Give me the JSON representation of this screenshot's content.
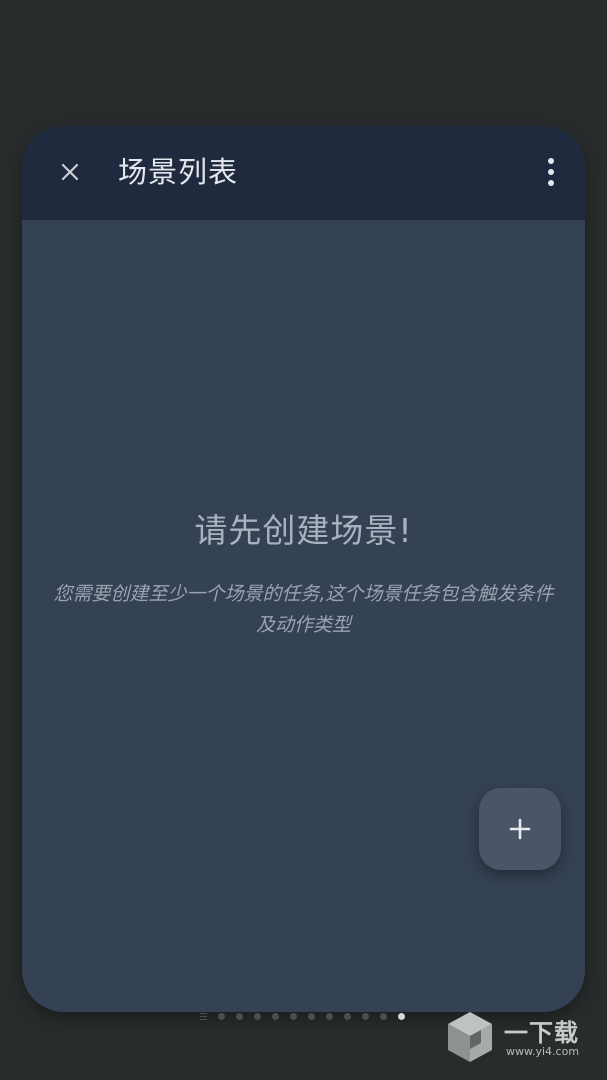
{
  "header": {
    "title": "场景列表",
    "close_icon": "close-icon",
    "more_icon": "more-vertical-icon"
  },
  "empty_state": {
    "title": "请先创建场景!",
    "description": "您需要创建至少一个场景的任务,这个场景任务包含触发条件及动作类型"
  },
  "fab": {
    "icon": "plus-icon"
  },
  "pager": {
    "dot_count": 11,
    "active_index": 10
  },
  "watermark": {
    "brand": "一下载",
    "url": "www.yi4.com"
  },
  "colors": {
    "background": "#292c2c",
    "card": "#354154",
    "header": "#202a3e",
    "fab": "#4a5668"
  }
}
